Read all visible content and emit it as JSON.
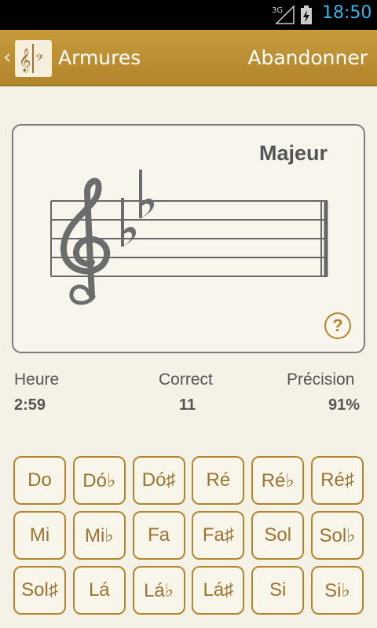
{
  "status_bar": {
    "network": "3G",
    "time": "18:50"
  },
  "action_bar": {
    "title": "Armures",
    "action": "Abandonner",
    "back_icon": "chevron-left-icon",
    "logo_icon": "treble-bass-clef-logo-icon"
  },
  "card": {
    "mode": "Majeur",
    "clef": "treble",
    "key_signature": [
      "B♭",
      "E♭"
    ],
    "help_label": "?"
  },
  "stats": {
    "time_label": "Heure",
    "time_value": "2:59",
    "correct_label": "Correct",
    "correct_value": "11",
    "precision_label": "Précision",
    "precision_value": "91%"
  },
  "answers": [
    "Do",
    "Dó♭",
    "Dó♯",
    "Ré",
    "Ré♭",
    "Ré♯",
    "Mi",
    "Mi♭",
    "Fa",
    "Fa♯",
    "Sol",
    "Sol♭",
    "Sol♯",
    "Lá",
    "Lá♭",
    "Lá♯",
    "Si",
    "Si♭"
  ],
  "colors": {
    "accent": "#b3852c",
    "status_time": "#33b5e5",
    "background": "#f4f1e7"
  }
}
